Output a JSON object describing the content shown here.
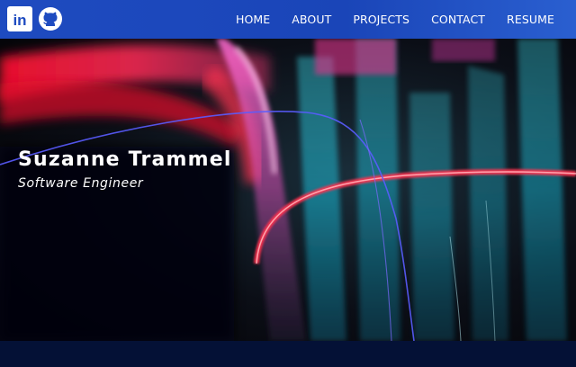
{
  "social": {
    "items": [
      {
        "icon": "linkedin-icon",
        "label": "in"
      },
      {
        "icon": "github-icon"
      }
    ]
  },
  "nav": {
    "links": [
      "HOME",
      "ABOUT",
      "PROJECTS",
      "CONTACT",
      "RESUME"
    ]
  },
  "hero": {
    "name": "Suzanne Trammel",
    "role": "Software Engineer"
  },
  "colors": {
    "navbar": "#1e4bc0",
    "footer": "#041136",
    "text": "#ffffff"
  }
}
